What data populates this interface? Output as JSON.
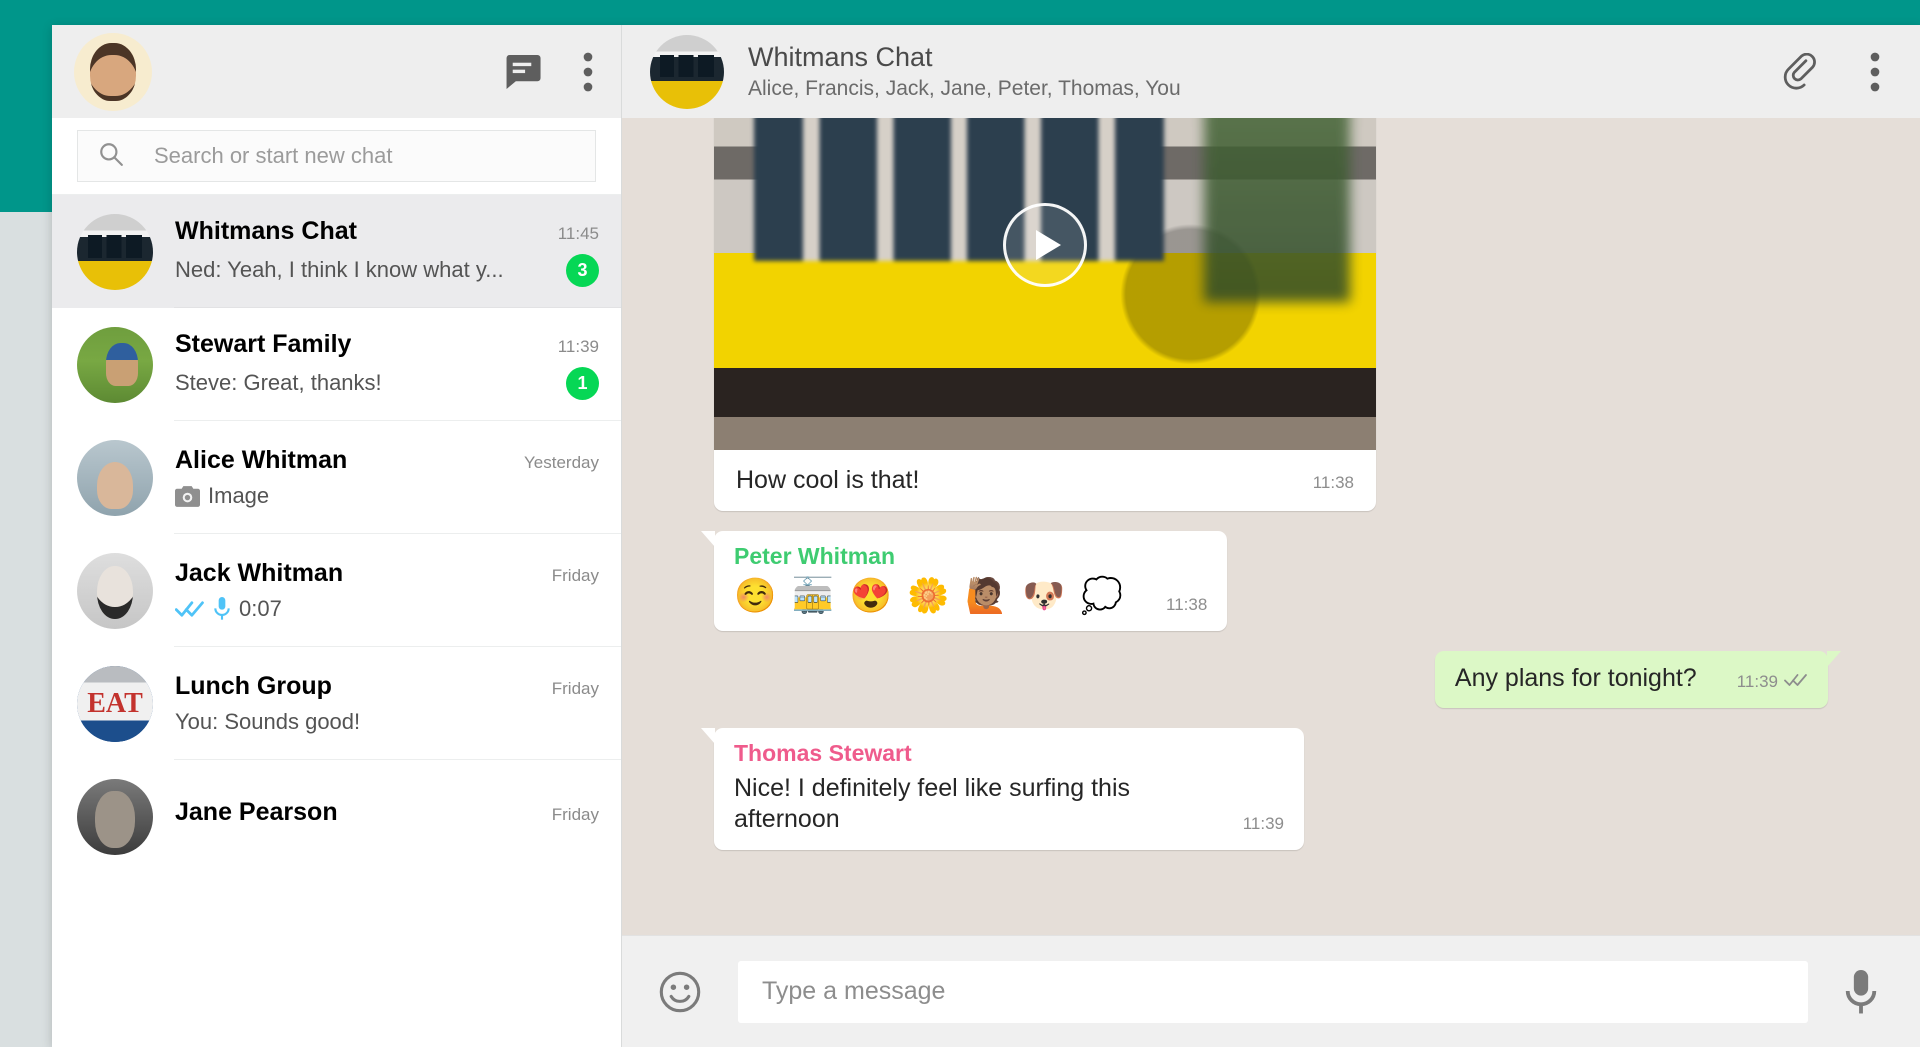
{
  "theme": {
    "teal": "#00968a",
    "page_bg": "#d9dfe0",
    "panel_bg": "#e5ded8",
    "badge_green": "#06d755",
    "out_bubble": "#dcf8c6",
    "sender_peter": "#3ecc71",
    "sender_thomas": "#ef5b8c",
    "tick_blue": "#4fc3f7"
  },
  "sidebar": {
    "avatar_name": "user-avatar",
    "new_chat_icon": "new-chat-icon",
    "menu_icon": "overflow-menu-icon",
    "search": {
      "icon": "search-icon",
      "placeholder": "Search or start new chat",
      "value": ""
    },
    "chats": [
      {
        "name": "Whitmans Chat",
        "preview": "Ned: Yeah, I think I know what y...",
        "time": "11:45",
        "badge": "3",
        "active": true,
        "avatar": "art-tram",
        "preview_icon": "none"
      },
      {
        "name": "Stewart Family",
        "preview": "Steve: Great, thanks!",
        "time": "11:39",
        "badge": "1",
        "active": false,
        "avatar": "art-grass",
        "preview_icon": "none"
      },
      {
        "name": "Alice Whitman",
        "preview": "Image",
        "time": "Yesterday",
        "badge": "",
        "active": false,
        "avatar": "art-alice",
        "preview_icon": "camera-icon"
      },
      {
        "name": "Jack Whitman",
        "preview": "0:07",
        "time": "Friday",
        "badge": "",
        "active": false,
        "avatar": "art-jack",
        "preview_icon": "read-receipt-mic"
      },
      {
        "name": "Lunch Group",
        "preview": "You: Sounds good!",
        "time": "Friday",
        "badge": "",
        "active": false,
        "avatar": "art-eat",
        "preview_icon": "none"
      },
      {
        "name": "Jane Pearson",
        "preview": "",
        "time": "Friday",
        "badge": "",
        "active": false,
        "avatar": "art-jane",
        "preview_icon": "none"
      }
    ]
  },
  "chat": {
    "title": "Whitmans Chat",
    "participants": "Alice, Francis, Jack, Jane, Peter, Thomas, You",
    "attach_icon": "paperclip-icon",
    "menu_icon": "overflow-menu-icon",
    "messages": [
      {
        "type": "media",
        "direction": "in",
        "caption": "How cool is that!",
        "time": "11:38",
        "play_icon": "play-icon"
      },
      {
        "type": "emoji",
        "direction": "in",
        "sender": "Peter Whitman",
        "sender_color": "#3ecc71",
        "emojis": "☺️ 🚋 😍 🌼 🙋🏽 🐶 💭",
        "time": "11:38"
      },
      {
        "type": "text",
        "direction": "out",
        "text": "Any plans for tonight?",
        "time": "11:39",
        "status_icon": "double-check-icon"
      },
      {
        "type": "text",
        "direction": "in",
        "sender": "Thomas Stewart",
        "sender_color": "#ef5b8c",
        "text": "Nice! I definitely feel like surfing this afternoon",
        "time": "11:39"
      }
    ],
    "compose": {
      "emoji_icon": "emoji-icon",
      "placeholder": "Type a message",
      "value": "",
      "mic_icon": "microphone-icon"
    }
  }
}
